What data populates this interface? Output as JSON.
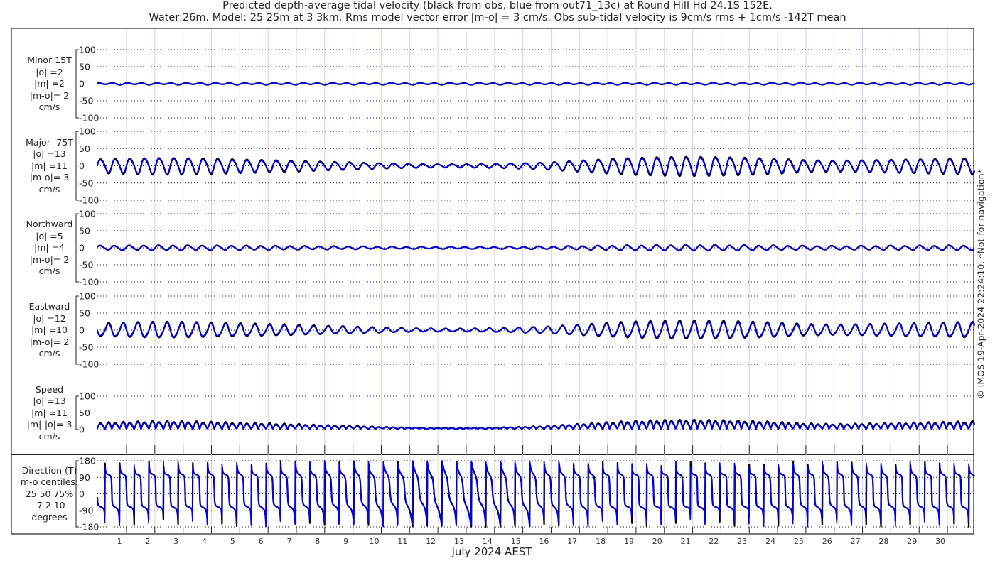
{
  "chart_data": {
    "type": "line",
    "title": "Predicted depth-average tidal velocity (black from obs, blue from out71_13c) at Round Hill Hd 24.1S 152E.",
    "subtitle": "Water:26m. Model: 25 25m at 3 3km. Rms model vector error |m-o| = 3 cm/s. Obs sub-tidal velocity is 9cm/s rms + 1cm/s -142T mean",
    "xlabel": "July 2024 AEST",
    "x_tick_labels": [
      "1",
      "2",
      "3",
      "4",
      "5",
      "6",
      "7",
      "8",
      "9",
      "10",
      "11",
      "12",
      "13",
      "14",
      "15",
      "16",
      "17",
      "18",
      "19",
      "20",
      "21",
      "22",
      "23",
      "24",
      "25",
      "26",
      "27",
      "28",
      "29",
      "30"
    ],
    "side_note": "© IMOS 19-Apr-2024 22:24:10. *Not for navigation*",
    "series_colors": {
      "obs": "#000000",
      "model": "#0000ee"
    },
    "tidal_period_hours": 12.42,
    "major_amplitude_by_day_obs": [
      20,
      22,
      24,
      24,
      22,
      20,
      18,
      16,
      13,
      11,
      8,
      6,
      5,
      5,
      6,
      8,
      11,
      16,
      21,
      25,
      27,
      28,
      27,
      25,
      22,
      18,
      16,
      17,
      19,
      20,
      22
    ],
    "major_amplitude_by_day_model": [
      17,
      19,
      21,
      21,
      19,
      17,
      15,
      13,
      11,
      9,
      7,
      5,
      4,
      4,
      5,
      7,
      10,
      14,
      18,
      21,
      23,
      24,
      23,
      21,
      19,
      15,
      14,
      15,
      17,
      18,
      19
    ],
    "minor_amplitude_obs": 2.5,
    "minor_amplitude_model": 2.2,
    "major_axis_direction_T": -75,
    "minor_axis_direction_T": 15,
    "panels": [
      {
        "name": "minor",
        "label": [
          "Minor 15T",
          "|o| =2",
          "|m| =2",
          "|m-o|= 2",
          "cm/s"
        ],
        "ylim": [
          -100,
          100
        ],
        "ticks": [
          "100",
          "50",
          "0",
          "-50",
          "-100"
        ]
      },
      {
        "name": "major",
        "label": [
          "Major -75T",
          "|o| =13",
          "|m| =11",
          "|m-o|= 3",
          "cm/s"
        ],
        "ylim": [
          -100,
          100
        ],
        "ticks": [
          "100",
          "50",
          "0",
          "-50",
          "-100"
        ]
      },
      {
        "name": "northward",
        "label": [
          "Northward",
          "|o| =5",
          "|m| =4",
          "|m-o|= 2",
          "cm/s"
        ],
        "ylim": [
          -100,
          100
        ],
        "ticks": [
          "100",
          "50",
          "0",
          "-50",
          "-100"
        ]
      },
      {
        "name": "eastward",
        "label": [
          "Eastward",
          "|o| =12",
          "|m| =10",
          "|m-o|= 2",
          "cm/s"
        ],
        "ylim": [
          -100,
          100
        ],
        "ticks": [
          "100",
          "50",
          "0",
          "-50",
          "-100"
        ]
      },
      {
        "name": "speed",
        "label": [
          "Speed",
          "|o| =13",
          "|m| =11",
          "|m|-|o|= 3",
          "cm/s"
        ],
        "ylim": [
          0,
          100
        ],
        "ticks": [
          "100",
          "50",
          "0"
        ]
      },
      {
        "name": "direction",
        "label": [
          "Direction (T)",
          "m-o centiles:",
          "25  50  75%",
          "-7  2 10",
          "degrees"
        ],
        "ylim": [
          -180,
          180
        ],
        "ticks": [
          "180",
          "90",
          "0",
          "-90",
          "-180"
        ]
      }
    ]
  }
}
